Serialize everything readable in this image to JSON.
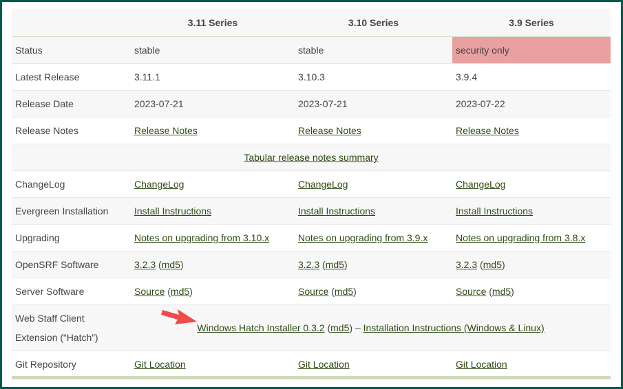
{
  "header": {
    "columns": [
      "",
      "3.11 Series",
      "3.10 Series",
      "3.9 Series"
    ]
  },
  "rows": {
    "status": {
      "label": "Status",
      "values": [
        "stable",
        "stable",
        "security only"
      ]
    },
    "latest_release": {
      "label": "Latest Release",
      "values": [
        "3.11.1",
        "3.10.3",
        "3.9.4"
      ]
    },
    "release_date": {
      "label": "Release Date",
      "values": [
        "2023-07-21",
        "2023-07-21",
        "2023-07-22"
      ]
    },
    "release_notes": {
      "label": "Release Notes",
      "values": [
        "Release Notes",
        "Release Notes",
        "Release Notes"
      ]
    },
    "tabular_summary": {
      "link": "Tabular release notes summary"
    },
    "changelog": {
      "label": "ChangeLog",
      "values": [
        "ChangeLog",
        "ChangeLog",
        "ChangeLog"
      ]
    },
    "install": {
      "label": "Evergreen Installation",
      "values": [
        "Install Instructions",
        "Install Instructions",
        "Install Instructions"
      ]
    },
    "upgrading": {
      "label": "Upgrading",
      "values": [
        "Notes on upgrading from 3.10.x",
        "Notes on upgrading from 3.9.x",
        "Notes on upgrading from 3.8.x"
      ]
    },
    "opensrf": {
      "label": "OpenSRF Software",
      "version": "3.2.3",
      "md5": "md5"
    },
    "server": {
      "label": "Server Software",
      "source": "Source",
      "md5": "md5"
    },
    "hatch": {
      "label_line1": "Web Staff Client",
      "label_line2": "Extension (“Hatch”)",
      "installer": "Windows Hatch Installer 0.3.2",
      "md5": "md5",
      "separator": "–",
      "instructions": "Installation Instructions (Windows & Linux)"
    },
    "git": {
      "label": "Git Repository",
      "values": [
        "Git Location",
        "Git Location",
        "Git Location"
      ]
    }
  },
  "colors": {
    "frame": "#005a4b",
    "security_only_bg": "#e8a0a0",
    "link": "#2e4b14",
    "arrow": "#f04a4a"
  }
}
